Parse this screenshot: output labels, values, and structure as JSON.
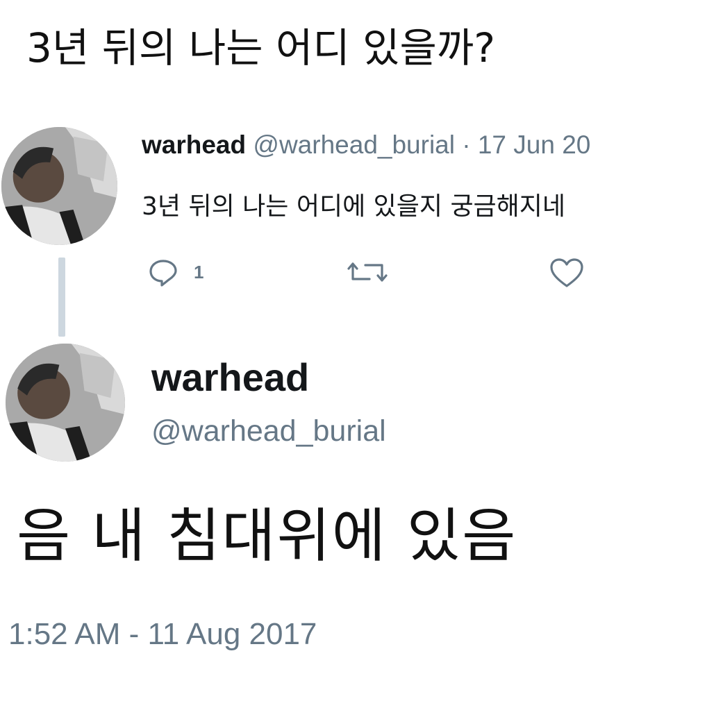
{
  "caption": "3년 뒤의 나는 어디 있을까?",
  "tweet_original": {
    "name": "warhead",
    "handle_date": "@warhead_burial · 17 Jun 20",
    "text": "3년 뒤의 나는 어디에 있을지 궁금해지네",
    "reply_count": "1",
    "icons": [
      "reply-icon",
      "retweet-icon",
      "like-icon"
    ]
  },
  "tweet_reply": {
    "name": "warhead",
    "handle": "@warhead_burial",
    "text": "음 내 침대위에 있음",
    "timestamp": "1:52 AM - 11 Aug 2017"
  },
  "colors": {
    "secondary_text": "#657786",
    "primary_text": "#14171a",
    "thread_line": "#cdd7df"
  }
}
